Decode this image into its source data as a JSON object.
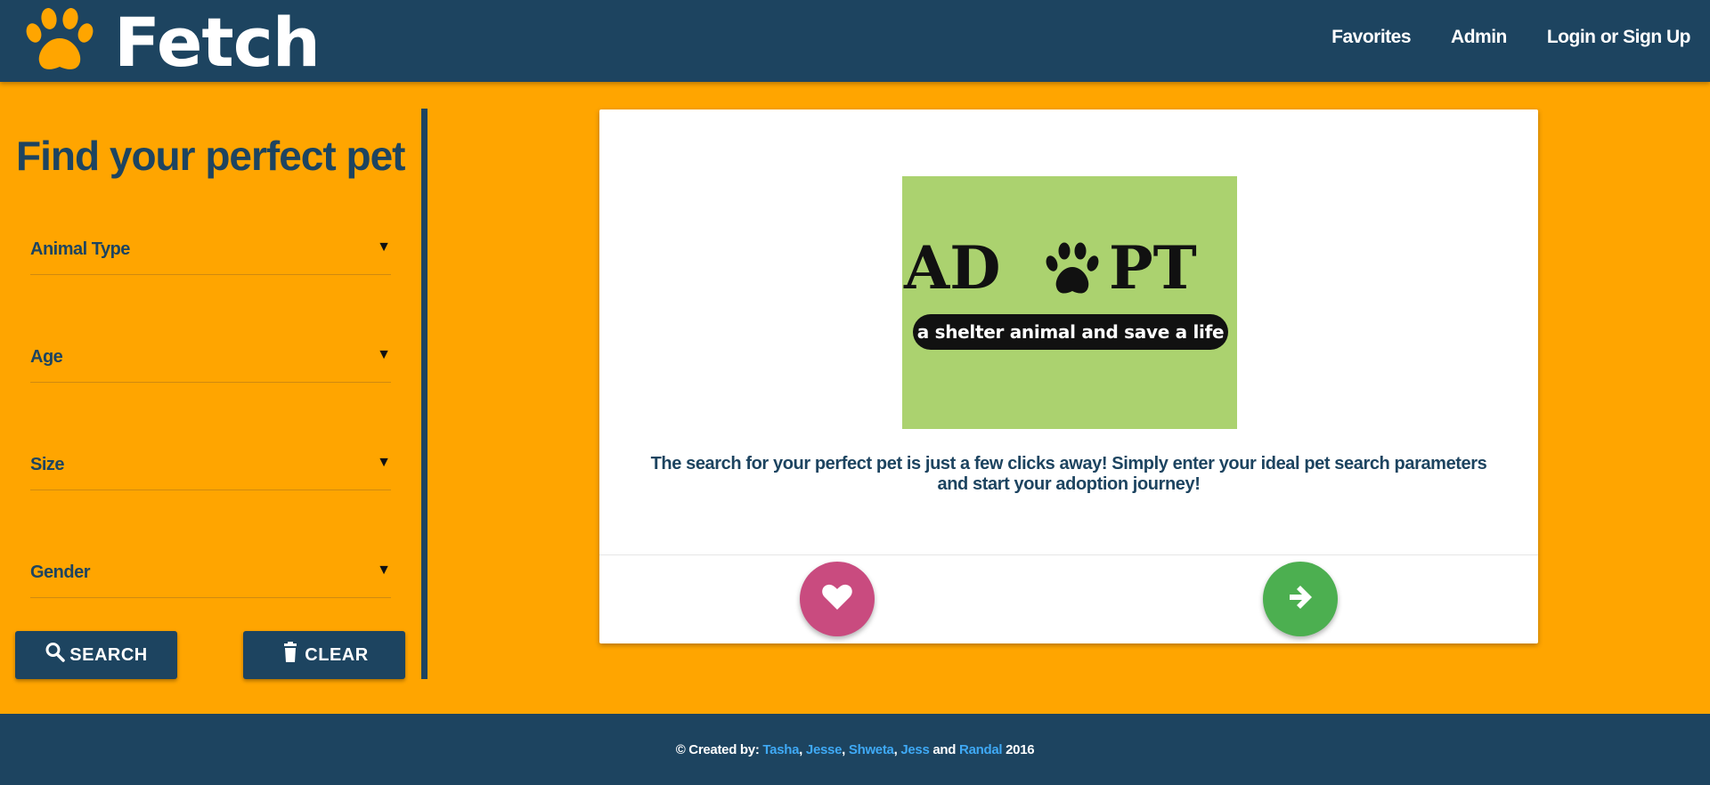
{
  "navbar": {
    "brand": "Fetch",
    "links": [
      "Favorites",
      "Admin",
      "Login or Sign Up"
    ]
  },
  "sidebar": {
    "title": "Find your perfect pet",
    "filters": [
      {
        "label": "Animal Type"
      },
      {
        "label": "Age"
      },
      {
        "label": "Size"
      },
      {
        "label": "Gender"
      }
    ],
    "search_label": "SEARCH",
    "clear_label": "CLEAR"
  },
  "card": {
    "image": {
      "word": "ADOPT",
      "banner": "a shelter animal and save a life"
    },
    "text": "The search for your perfect pet is just a few clicks away! Simply enter your ideal pet search parameters and start your adoption journey!",
    "favorite_color": "#c94b7f",
    "next_color": "#4caf50"
  },
  "footer": {
    "prefix": "© Created by:",
    "names": [
      "Tasha",
      "Jesse",
      "Shweta",
      "Jess",
      "Randal"
    ],
    "and": "and",
    "year": "2016"
  },
  "colors": {
    "primary": "#1d4460",
    "accent": "#ffa500",
    "link": "#3fa9f5"
  }
}
